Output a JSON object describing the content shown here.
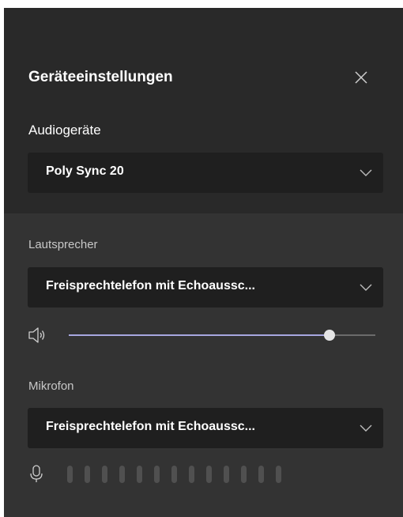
{
  "dialog": {
    "title": "Geräteeinstellungen"
  },
  "audio_devices": {
    "label": "Audiogeräte",
    "selected": "Poly Sync 20"
  },
  "speaker": {
    "label": "Lautsprecher",
    "selected": "Freisprechtelefon mit Echoaussc...",
    "volume_percent": 85
  },
  "microphone": {
    "label": "Mikrofon",
    "selected": "Freisprechtelefon mit Echoaussc...",
    "level_bar_count": 13,
    "level_active": 0
  },
  "colors": {
    "accent": "#a8a8e0",
    "panel_top": "#292929",
    "panel_bottom": "#333333",
    "dropdown_bg": "#1f1f1f"
  },
  "icons": {
    "close": "close-icon",
    "chevron": "chevron-down-icon",
    "speaker": "speaker-icon",
    "microphone": "microphone-icon"
  }
}
